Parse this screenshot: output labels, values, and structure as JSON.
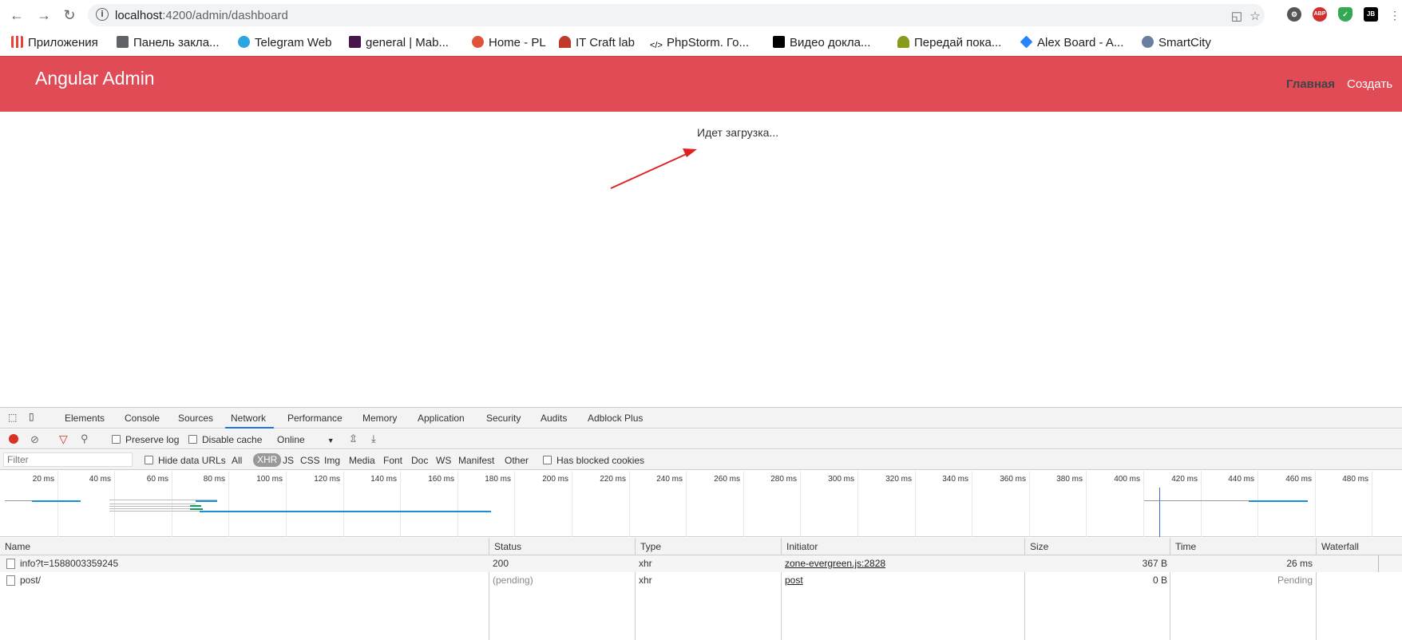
{
  "browser": {
    "url_host": "localhost",
    "url_path": ":4200/admin/dashboard",
    "extensions": [
      "translate-icon",
      "star-icon",
      "settings-ext-icon",
      "abp-icon",
      "shield-ext-icon",
      "jb-icon"
    ],
    "ext_labels": {
      "abp": "ABP",
      "jb": "JB"
    }
  },
  "bookmarks": [
    {
      "label": "Приложения",
      "icon": "apps-grid-icon",
      "color": "#1a73e8"
    },
    {
      "label": "Панель закла...",
      "icon": "folder-icon",
      "color": "#5f6368"
    },
    {
      "label": "Telegram Web",
      "icon": "telegram-icon",
      "color": "#2ca5e0"
    },
    {
      "label": "general | Mab...",
      "icon": "slack-icon",
      "color": "#4a154b"
    },
    {
      "label": "Home - PL",
      "icon": "pl-icon",
      "color": "#e0523a"
    },
    {
      "label": "IT Craft lab",
      "icon": "itcraft-icon",
      "color": "#c0392b"
    },
    {
      "label": "PhpStorm. Го...",
      "icon": "code-icon",
      "color": "#000"
    },
    {
      "label": "Видео доклa...",
      "icon": "dou-icon",
      "color": "#000"
    },
    {
      "label": "Передай пока...",
      "icon": "person-icon",
      "color": "#8a9a1a"
    },
    {
      "label": "Alex Board - A...",
      "icon": "jira-icon",
      "color": "#2684ff"
    },
    {
      "label": "SmartCity",
      "icon": "smartcity-icon",
      "color": "#6c7ea0"
    }
  ],
  "app": {
    "title": "Angular Admin",
    "nav": [
      {
        "label": "Главная",
        "active": true
      },
      {
        "label": "Создать",
        "active": false
      }
    ],
    "header_color": "#e04b56",
    "loading_text": "Идет загрузка..."
  },
  "devtools": {
    "tabs": [
      "Elements",
      "Console",
      "Sources",
      "Network",
      "Performance",
      "Memory",
      "Application",
      "Security",
      "Audits",
      "Adblock Plus"
    ],
    "active_tab": "Network",
    "toolbar": {
      "preserve_log": "Preserve log",
      "disable_cache": "Disable cache",
      "throttle": "Online"
    },
    "filter": {
      "placeholder": "Filter",
      "hide_data_urls": "Hide data URLs",
      "types": [
        "All",
        "XHR",
        "JS",
        "CSS",
        "Img",
        "Media",
        "Font",
        "Doc",
        "WS",
        "Manifest",
        "Other"
      ],
      "active_type": "XHR",
      "blocked_cookies": "Has blocked cookies"
    },
    "timeline_ticks": [
      "20 ms",
      "40 ms",
      "60 ms",
      "80 ms",
      "100 ms",
      "120 ms",
      "140 ms",
      "160 ms",
      "180 ms",
      "200 ms",
      "220 ms",
      "240 ms",
      "260 ms",
      "280 ms",
      "300 ms",
      "320 ms",
      "340 ms",
      "360 ms",
      "380 ms",
      "400 ms",
      "420 ms",
      "440 ms",
      "460 ms",
      "480 ms"
    ],
    "columns": [
      "Name",
      "Status",
      "Type",
      "Initiator",
      "Size",
      "Time",
      "Waterfall"
    ],
    "rows": [
      {
        "name": "info?t=1588003359245",
        "status": "200",
        "type": "xhr",
        "initiator": "zone-evergreen.js:2828",
        "size": "367 B",
        "time": "26 ms"
      },
      {
        "name": "post/",
        "status": "(pending)",
        "type": "xhr",
        "initiator": "post",
        "size": "0 B",
        "time": "Pending"
      }
    ]
  }
}
